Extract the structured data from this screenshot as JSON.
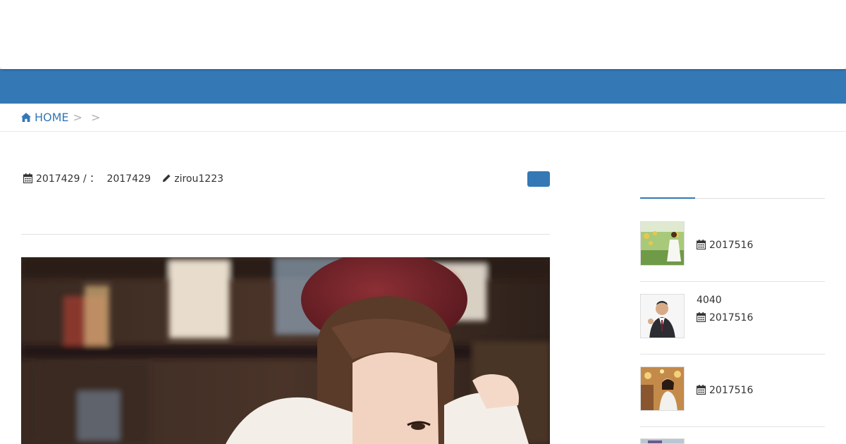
{
  "header": {
    "site_title": ""
  },
  "breadcrumb": {
    "home_label": "HOME",
    "separator_1": ">",
    "separator_2": ">"
  },
  "post_meta": {
    "published_date": "2017429",
    "slash": "/",
    "updated_label": "：",
    "updated_date": "2017429",
    "author": "zirou1223"
  },
  "category_button": {
    "label": ""
  },
  "sidebar": {
    "posts": [
      {
        "title": "",
        "date": "2017516",
        "thumb_icon": "woman-in-sunflower-field-photo"
      },
      {
        "title": "4040",
        "date": "2017516",
        "thumb_icon": "man-in-suit-waving-photo"
      },
      {
        "title": "",
        "date": "2017516",
        "thumb_icon": "woman-at-party-photo"
      }
    ]
  },
  "colors": {
    "accent": "#3478b5",
    "text": "#333333",
    "rule": "#e3e3e3"
  }
}
